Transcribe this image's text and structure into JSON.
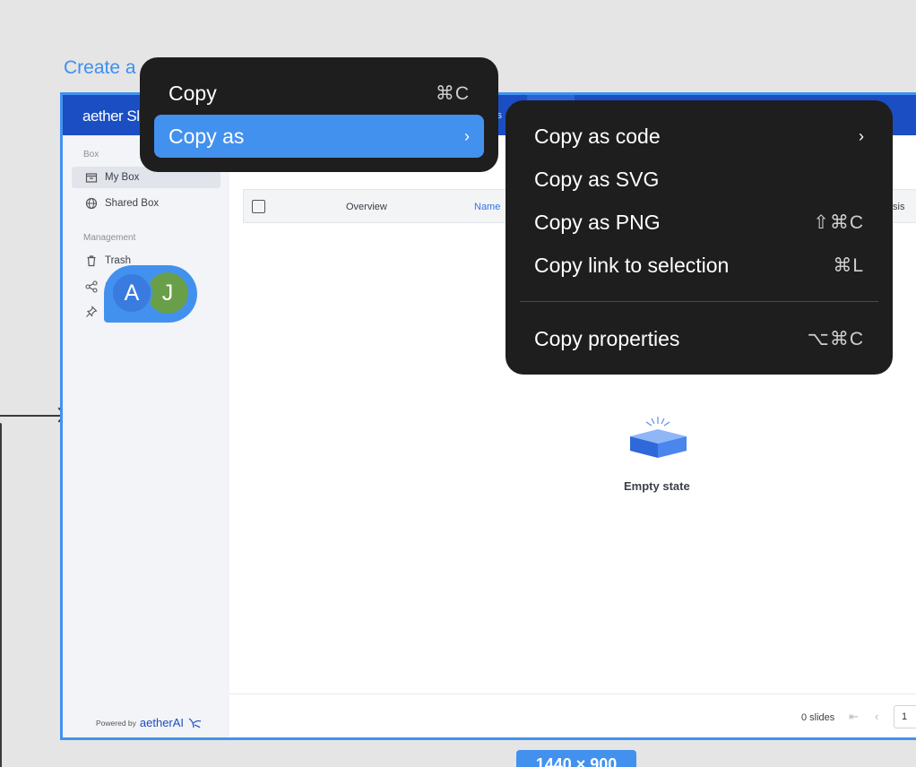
{
  "canvas": {
    "frame_title": "Create a",
    "dimensions_badge": "1440 × 900"
  },
  "app": {
    "logo": "aether Sl",
    "topbar_partial_text": "is"
  },
  "sidebar": {
    "group_box": "Box",
    "items_box": [
      {
        "label": "My Box",
        "icon": "box-icon",
        "active": true
      },
      {
        "label": "Shared Box",
        "icon": "globe-icon",
        "active": false
      }
    ],
    "group_management": "Management",
    "items_management": [
      {
        "label": "Trash",
        "icon": "trash-icon"
      },
      {
        "label": "S",
        "icon": "share-icon"
      },
      {
        "label": "",
        "icon": "pin-icon"
      }
    ],
    "powered_by": "Powered by",
    "powered_brand": "aetherAI"
  },
  "collaborators": [
    {
      "initial": "A",
      "color": "#3a7be0"
    },
    {
      "initial": "J",
      "color": "#6a9f49"
    }
  ],
  "table": {
    "headers": [
      "Overview",
      "Name"
    ],
    "header_tail": "sis"
  },
  "empty_state": {
    "label": "Empty state"
  },
  "footer": {
    "slides_count": "0 slides",
    "page": "1"
  },
  "context_menu": {
    "items": [
      {
        "label": "Copy",
        "shortcut": "⌘C",
        "active": false
      },
      {
        "label": "Copy as",
        "shortcut": "",
        "has_submenu": true,
        "active": true
      }
    ]
  },
  "submenu": {
    "items": [
      {
        "label": "Copy as code",
        "shortcut": "",
        "has_submenu": true
      },
      {
        "label": "Copy as SVG",
        "shortcut": ""
      },
      {
        "label": "Copy as PNG",
        "shortcut": "⇧⌘C"
      },
      {
        "label": "Copy link to selection",
        "shortcut": "⌘L"
      },
      {
        "label": "Copy properties",
        "shortcut": "⌥⌘C"
      }
    ]
  },
  "colors": {
    "accent": "#4391ee",
    "brand": "#1a4ec2",
    "menu_bg": "#1e1e1e"
  }
}
